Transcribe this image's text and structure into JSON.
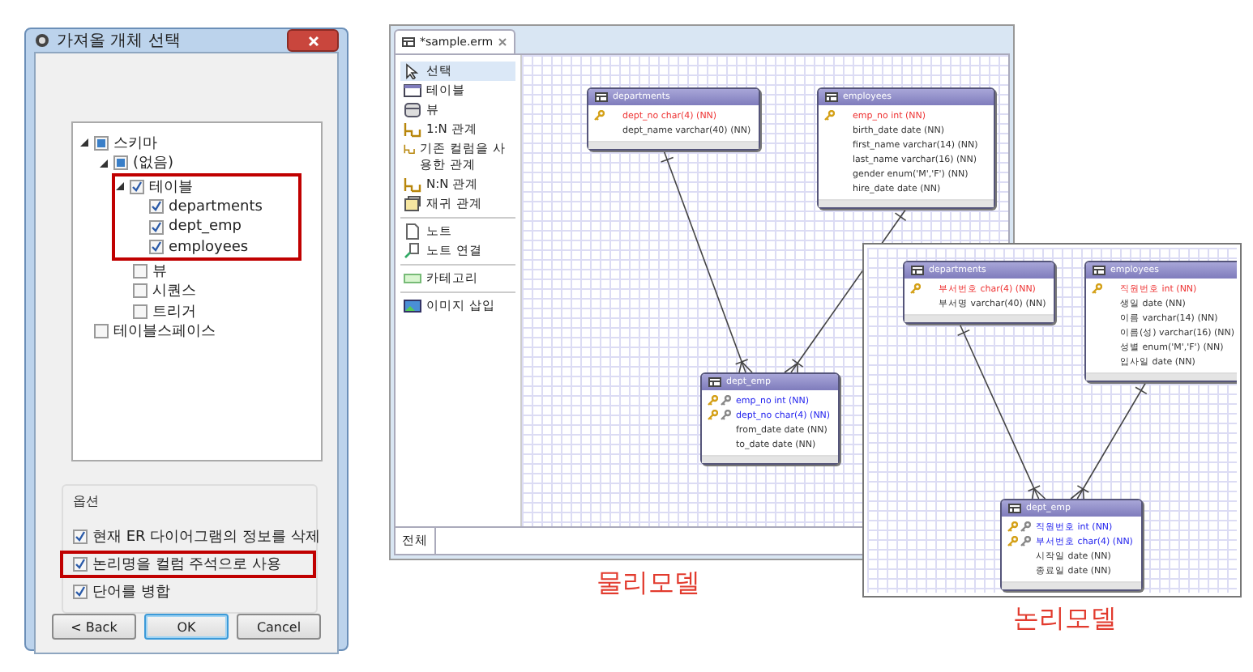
{
  "dialog": {
    "title": "가져올 개체 선택",
    "tree": [
      {
        "label": "스키마",
        "checked": false,
        "partial": true,
        "expanded": true,
        "children": [
          {
            "label": "(없음)",
            "checked": false,
            "partial": true,
            "expanded": true,
            "children": [
              {
                "label": "테이블",
                "checked": true,
                "expanded": true,
                "highlighted": true,
                "children": [
                  {
                    "label": "departments",
                    "checked": true
                  },
                  {
                    "label": "dept_emp",
                    "checked": true
                  },
                  {
                    "label": "employees",
                    "checked": true
                  }
                ]
              },
              {
                "label": "뷰",
                "checked": false
              },
              {
                "label": "시퀀스",
                "checked": false
              },
              {
                "label": "트리거",
                "checked": false
              }
            ]
          }
        ]
      },
      {
        "label": "테이블스페이스",
        "checked": false
      }
    ],
    "options_title": "옵션",
    "options": [
      {
        "label": "현재 ER 다이어그램의 정보를 삭제",
        "checked": true
      },
      {
        "label": "논리명을 컬럼 주석으로 사용",
        "checked": true,
        "highlighted": true
      },
      {
        "label": "단어를 병합",
        "checked": true
      }
    ],
    "buttons": [
      {
        "label": "< Back",
        "selected": false
      },
      {
        "label": "OK",
        "selected": true
      },
      {
        "label": "Cancel",
        "selected": false
      }
    ]
  },
  "physical_model": {
    "tab": "*sample.erm",
    "bottom_tab": "전체",
    "palette": [
      [
        {
          "label": "선택",
          "kind": "pointer",
          "selected": true
        },
        {
          "label": "테이블",
          "kind": "table",
          "selected": false
        },
        {
          "label": "뷰",
          "kind": "view",
          "selected": false
        },
        {
          "label": "1:N 관계",
          "kind": "relation",
          "selected": false
        },
        {
          "label": "기존 컬럼을 사용한 관계",
          "kind": "relation",
          "selected": false
        },
        {
          "label": "N:N 관계",
          "kind": "relation",
          "selected": false
        },
        {
          "label": "재귀 관계",
          "kind": "recursive",
          "selected": false
        }
      ],
      [
        {
          "label": "노트",
          "kind": "note",
          "selected": false
        },
        {
          "label": "노트 연결",
          "kind": "note-link",
          "selected": false
        }
      ],
      [
        {
          "label": "카테고리",
          "kind": "category",
          "selected": false
        }
      ],
      [
        {
          "label": "이미지 삽입",
          "kind": "image",
          "selected": false
        }
      ]
    ],
    "tables": [
      {
        "name": "departments",
        "columns": [
          {
            "text": "dept_no char(4) (NN)",
            "kind": "pk"
          },
          {
            "text": "dept_name varchar(40) (NN)",
            "kind": "plain"
          }
        ]
      },
      {
        "name": "employees",
        "columns": [
          {
            "text": "emp_no int (NN)",
            "kind": "pk"
          },
          {
            "text": "birth_date date (NN)",
            "kind": "plain"
          },
          {
            "text": "first_name varchar(14) (NN)",
            "kind": "plain"
          },
          {
            "text": "last_name varchar(16) (NN)",
            "kind": "plain"
          },
          {
            "text": "gender enum('M','F') (NN)",
            "kind": "plain"
          },
          {
            "text": "hire_date date (NN)",
            "kind": "plain"
          }
        ]
      },
      {
        "name": "dept_emp",
        "columns": [
          {
            "text": "emp_no int (NN)",
            "kind": "fk"
          },
          {
            "text": "dept_no char(4) (NN)",
            "kind": "fk"
          },
          {
            "text": "from_date date (NN)",
            "kind": "plain"
          },
          {
            "text": "to_date date (NN)",
            "kind": "plain"
          }
        ]
      }
    ],
    "caption": "물리모델"
  },
  "logical_model": {
    "tables": [
      {
        "name": "departments",
        "columns": [
          {
            "text": "부서번호 char(4) (NN)",
            "kind": "pk"
          },
          {
            "text": "부서명 varchar(40) (NN)",
            "kind": "plain"
          }
        ]
      },
      {
        "name": "employees",
        "columns": [
          {
            "text": "직원번호 int (NN)",
            "kind": "pk"
          },
          {
            "text": "생일 date (NN)",
            "kind": "plain"
          },
          {
            "text": "이름 varchar(14) (NN)",
            "kind": "plain"
          },
          {
            "text": "이름(성) varchar(16) (NN)",
            "kind": "plain"
          },
          {
            "text": "성별 enum('M','F') (NN)",
            "kind": "plain"
          },
          {
            "text": "입사일 date (NN)",
            "kind": "plain"
          }
        ]
      },
      {
        "name": "dept_emp",
        "columns": [
          {
            "text": "직원번호 int (NN)",
            "kind": "fk"
          },
          {
            "text": "부서번호 char(4) (NN)",
            "kind": "fk"
          },
          {
            "text": "시작일 date (NN)",
            "kind": "plain"
          },
          {
            "text": "종료일 date (NN)",
            "kind": "plain"
          }
        ]
      }
    ],
    "caption": "논리모델"
  }
}
